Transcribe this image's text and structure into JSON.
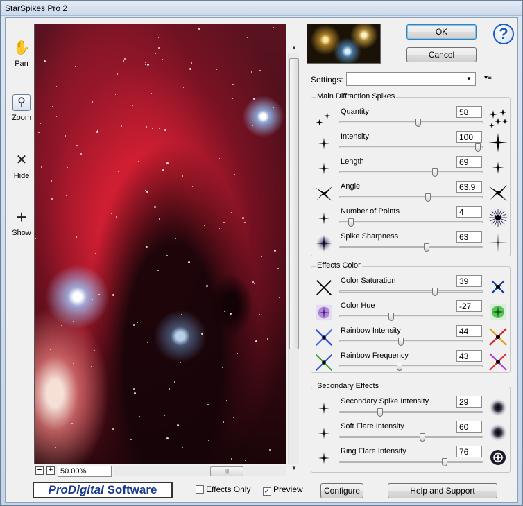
{
  "window": {
    "title": "StarSpikes Pro 2"
  },
  "tools": [
    {
      "label": "Pan",
      "icon": "hand-icon"
    },
    {
      "label": "Zoom",
      "icon": "magnifier-icon"
    },
    {
      "label": "Hide",
      "icon": "x-icon"
    },
    {
      "label": "Show",
      "icon": "plus-icon"
    }
  ],
  "zoom": {
    "value": "50.00%"
  },
  "buttons": {
    "ok": "OK",
    "cancel": "Cancel",
    "configure": "Configure",
    "help_support": "Help and Support",
    "help_glyph": "?"
  },
  "settings": {
    "label": "Settings:",
    "value": ""
  },
  "groups": {
    "main": {
      "title": "Main Diffraction Spikes",
      "rows": [
        {
          "name": "Quantity",
          "value": "58",
          "level": 0.57
        },
        {
          "name": "Intensity",
          "value": "100",
          "level": 1.0
        },
        {
          "name": "Length",
          "value": "69",
          "level": 0.69
        },
        {
          "name": "Angle",
          "value": "63.9",
          "level": 0.64
        },
        {
          "name": "Number of Points",
          "value": "4",
          "level": 0.08
        },
        {
          "name": "Spike Sharpness",
          "value": "63",
          "level": 0.63
        }
      ]
    },
    "color": {
      "title": "Effects Color",
      "rows": [
        {
          "name": "Color Saturation",
          "value": "39",
          "level": 0.69
        },
        {
          "name": "Color Hue",
          "value": "-27",
          "level": 0.37
        },
        {
          "name": "Rainbow Intensity",
          "value": "44",
          "level": 0.44
        },
        {
          "name": "Rainbow Frequency",
          "value": "43",
          "level": 0.43
        }
      ]
    },
    "secondary": {
      "title": "Secondary Effects",
      "rows": [
        {
          "name": "Secondary Spike Intensity",
          "value": "29",
          "level": 0.29
        },
        {
          "name": "Soft Flare Intensity",
          "value": "60",
          "level": 0.6
        },
        {
          "name": "Ring Flare Intensity",
          "value": "76",
          "level": 0.76
        }
      ]
    }
  },
  "footer": {
    "logo_pre": "Pro",
    "logo_mid": "Digital",
    "logo_post": " Software",
    "effects_only": {
      "label": "Effects Only",
      "checked": false
    },
    "preview": {
      "label": "Preview",
      "checked": true
    }
  }
}
